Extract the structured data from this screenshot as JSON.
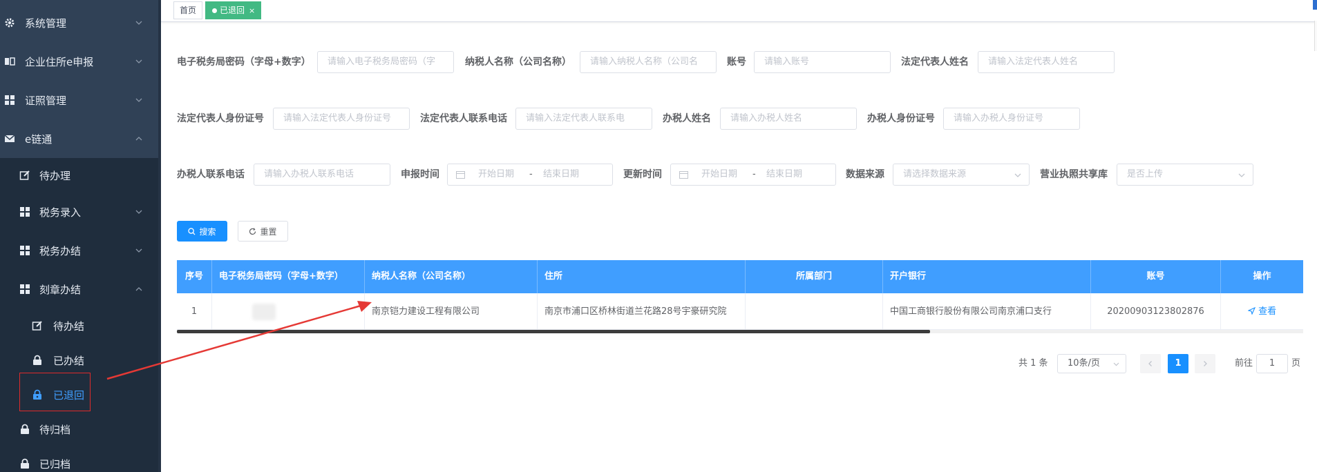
{
  "sidebar": {
    "items": [
      {
        "label": "系统管理",
        "icon": "gear-icon"
      },
      {
        "label": "企业住所e申报",
        "icon": "book-icon"
      },
      {
        "label": "证照管理",
        "icon": "grid-icon"
      },
      {
        "label": "e链通",
        "icon": "mail-icon"
      },
      {
        "label": "待办理",
        "icon": "edit-icon"
      },
      {
        "label": "税务录入",
        "icon": "grid-icon"
      },
      {
        "label": "税务办结",
        "icon": "grid-icon"
      },
      {
        "label": "刻章办结",
        "icon": "grid-icon"
      },
      {
        "label": "待办结",
        "icon": "edit-icon"
      },
      {
        "label": "已办结",
        "icon": "lock-icon"
      },
      {
        "label": "已退回",
        "icon": "lock-icon"
      },
      {
        "label": "待归档",
        "icon": "lock-icon"
      },
      {
        "label": "已归档",
        "icon": "lock-icon"
      }
    ]
  },
  "tags": {
    "home": "首页",
    "active": "已退回",
    "close": "×"
  },
  "form": {
    "tax_pwd": {
      "label": "电子税务局密码（字母+数字）",
      "placeholder": "请输入电子税务局密码（字"
    },
    "taxpayer_name": {
      "label": "纳税人名称（公司名称）",
      "placeholder": "请输入纳税人名称（公司名"
    },
    "account": {
      "label": "账号",
      "placeholder": "请输入账号"
    },
    "legal_name": {
      "label": "法定代表人姓名",
      "placeholder": "请输入法定代表人姓名"
    },
    "legal_id": {
      "label": "法定代表人身份证号",
      "placeholder": "请输入法定代表人身份证号"
    },
    "legal_phone": {
      "label": "法定代表人联系电话",
      "placeholder": "请输入法定代表人联系电"
    },
    "handler_name": {
      "label": "办税人姓名",
      "placeholder": "请输入办税人姓名"
    },
    "handler_id": {
      "label": "办税人身份证号",
      "placeholder": "请输入办税人身份证号"
    },
    "handler_phone": {
      "label": "办税人联系电话",
      "placeholder": "请输入办税人联系电话"
    },
    "apply_time": {
      "label": "申报时间",
      "start": "开始日期",
      "sep": "-",
      "end": "结束日期"
    },
    "update_time": {
      "label": "更新时间",
      "start": "开始日期",
      "sep": "-",
      "end": "结束日期"
    },
    "data_source": {
      "label": "数据来源",
      "placeholder": "请选择数据来源"
    },
    "share_lib": {
      "label": "营业执照共享库",
      "placeholder": "是否上传"
    },
    "search_btn": "搜索",
    "reset_btn": "重置"
  },
  "table": {
    "headers": [
      "序号",
      "电子税务局密码（字母+数字）",
      "纳税人名称（公司名称）",
      "住所",
      "所属部门",
      "开户银行",
      "账号",
      "操作"
    ],
    "rows": [
      {
        "index": "1",
        "tax_pwd": "",
        "name": "南京铠力建设工程有限公司",
        "address": "南京市浦口区桥林街道兰花路28号宇豪研究院",
        "dept": "",
        "bank": "中国工商银行股份有限公司南京浦口支行",
        "account": "20200903123802876",
        "action": "查看"
      }
    ]
  },
  "pagination": {
    "total": "共 1 条",
    "page_size": "10条/页",
    "current": "1",
    "goto_prefix": "前往",
    "goto_value": "1",
    "goto_suffix": "页"
  },
  "colors": {
    "sidebar_bg": "#304156",
    "submenu_bg": "#1f2d3d",
    "header_blue": "#409eff",
    "primary": "#1890ff",
    "tag_green": "#42b983",
    "annotation_red": "#e02b2b"
  }
}
